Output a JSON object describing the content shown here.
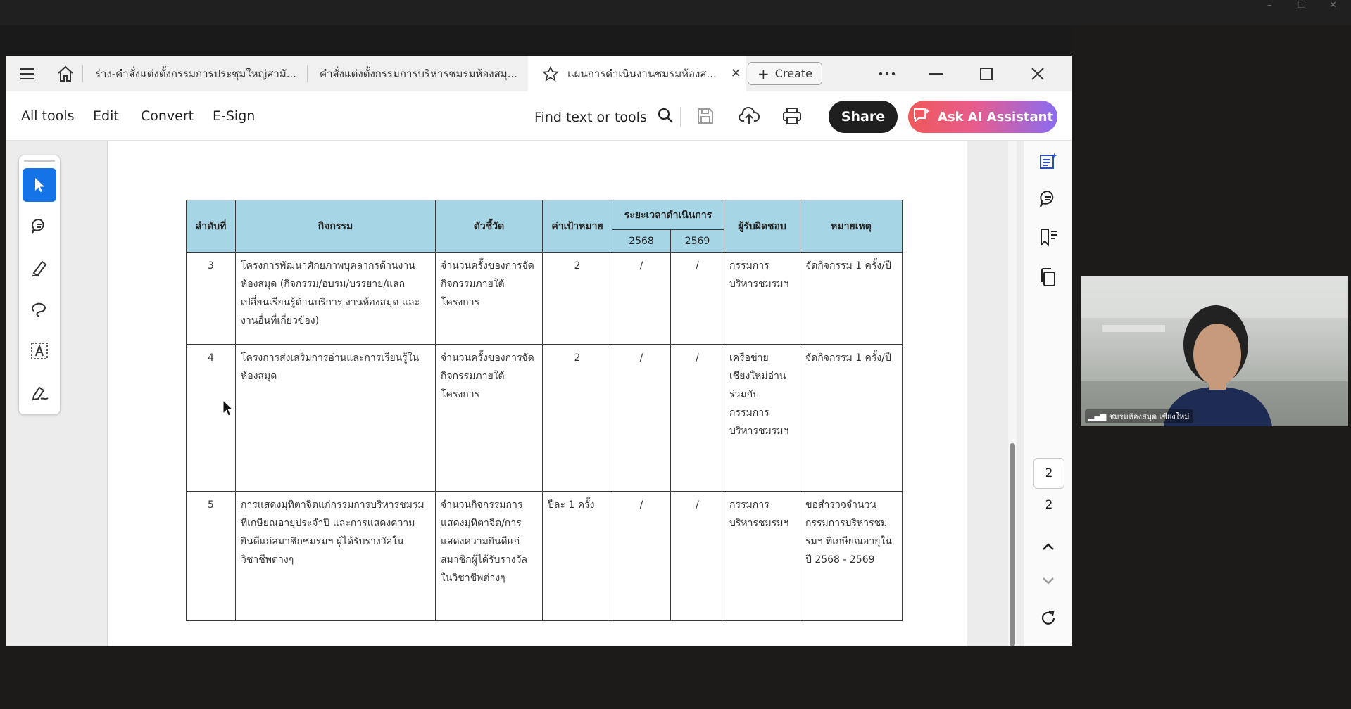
{
  "tabs": [
    {
      "label": "ร่าง-คำสั่งแต่งตั้งกรรมการประชุมใหญ่สามั..."
    },
    {
      "label": "คำสั่งแต่งตั้งกรรมการบริหารชมรมห้องสมุ..."
    },
    {
      "label": "แผนการดำเนินงานชมรมห้องส..."
    }
  ],
  "create_label": "Create",
  "menu": {
    "all_tools": "All tools",
    "edit": "Edit",
    "convert": "Convert",
    "esign": "E-Sign"
  },
  "find_label": "Find text or tools",
  "share_label": "Share",
  "ai_label": "Ask AI Assistant",
  "table": {
    "headers": {
      "no": "ลำดับที่",
      "activity": "กิจกรรม",
      "indicator": "ตัวชี้วัด",
      "target": "ค่าเป้าหมาย",
      "period": "ระยะเวลาดำเนินการ",
      "y1": "2568",
      "y2": "2569",
      "responsible": "ผู้รับผิดชอบ",
      "remark": "หมายเหตุ"
    },
    "rows": [
      {
        "no": "3",
        "activity": "โครงการพัฒนาศักยภาพบุคลากรด้านงานห้องสมุด (กิจกรรม/อบรม/บรรยาย/แลกเปลี่ยนเรียนรู้ด้านบริการ งานห้องสมุด และงานอื่นที่เกี่ยวข้อง)",
        "indicator": "จำนวนครั้งของการจัดกิจกรรมภายใต้โครงการ",
        "target": "2",
        "y1": "/",
        "y2": "/",
        "responsible": "กรรมการบริหารชมรมฯ",
        "remark": "จัดกิจกรรม 1 ครั้ง/ปี"
      },
      {
        "no": "4",
        "activity": "โครงการส่งเสริมการอ่านและการเรียนรู้ในห้องสมุด",
        "indicator": "จำนวนครั้งของการจัดกิจกรรมภายใต้โครงการ",
        "target": "2",
        "y1": "/",
        "y2": "/",
        "responsible": "เครือข่ายเชียงใหม่อ่าน ร่วมกับ กรรมการบริหารชมรมฯ",
        "remark": "จัดกิจกรรม 1 ครั้ง/ปี"
      },
      {
        "no": "5",
        "activity": "การแสดงมุทิตาจิตแก่กรรมการบริหารชมรมที่เกษียณอายุประจำปี และการแสดงความยินดีแก่สมาชิกชมรมฯ ผู้ได้รับรางวัลในวิชาชีพต่างๆ",
        "indicator": "จำนวนกิจกรรมการแสดงมุทิตาจิต/การแสดงความยินดีแก่สมาชิกผู้ได้รับรางวัลในวิชาชีพต่างๆ",
        "target": "ปีละ 1 ครั้ง",
        "y1": "/",
        "y2": "/",
        "responsible": "กรรมการบริหารชมรมฯ",
        "remark": "ขอสำรวจจำนวนกรรมการบริหารชมรมฯ ที่เกษียณอายุในปี 2568 - 2569"
      }
    ]
  },
  "page_current": "2",
  "page_total": "2",
  "webcam_name": "ชมรมห้องสมุด เชียงใหม่"
}
